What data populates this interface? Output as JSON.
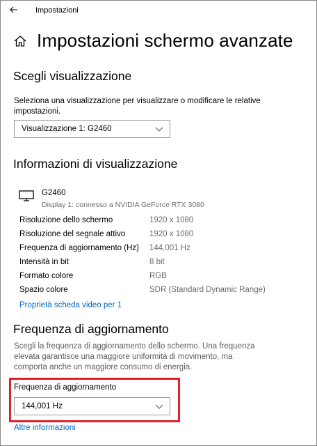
{
  "app": {
    "title": "Impostazioni"
  },
  "page": {
    "title": "Impostazioni schermo avanzate"
  },
  "choose_display": {
    "heading": "Scegli visualizzazione",
    "description": "Seleziona una visualizzazione per visualizzare o modificare le relative impostazioni.",
    "selected": "Visualizzazione 1: G2460"
  },
  "display_info": {
    "heading": "Informazioni di visualizzazione",
    "monitor_name": "G2460",
    "monitor_subtitle": "Display 1: connesso a NVIDIA GeForce RTX 3080",
    "rows": [
      {
        "label": "Risoluzione dello schermo",
        "value": "1920 x 1080"
      },
      {
        "label": "Risoluzione del segnale attivo",
        "value": "1920 x 1080"
      },
      {
        "label": "Frequenza di aggiornamento (Hz)",
        "value": "144,001 Hz"
      },
      {
        "label": "Intensità in bit",
        "value": "8 bit"
      },
      {
        "label": "Formato colore",
        "value": "RGB"
      },
      {
        "label": "Spazio colore",
        "value": "SDR (Standard Dynamic Range)"
      }
    ],
    "adapter_link": "Proprietà scheda video per 1"
  },
  "refresh_rate": {
    "heading": "Frequenza di aggiornamento",
    "description": "Scegli la frequenza di aggiornamento dello schermo. Una frequenza elevata garantisce una maggiore uniformità di movimento, ma comporta anche un maggiore consumo di energia.",
    "label": "Frequenza di aggiornamento",
    "selected": "144,001 Hz",
    "more_link": "Altre informazioni"
  },
  "colors": {
    "accent_link": "#0067c0",
    "highlight": "#e0212a"
  }
}
